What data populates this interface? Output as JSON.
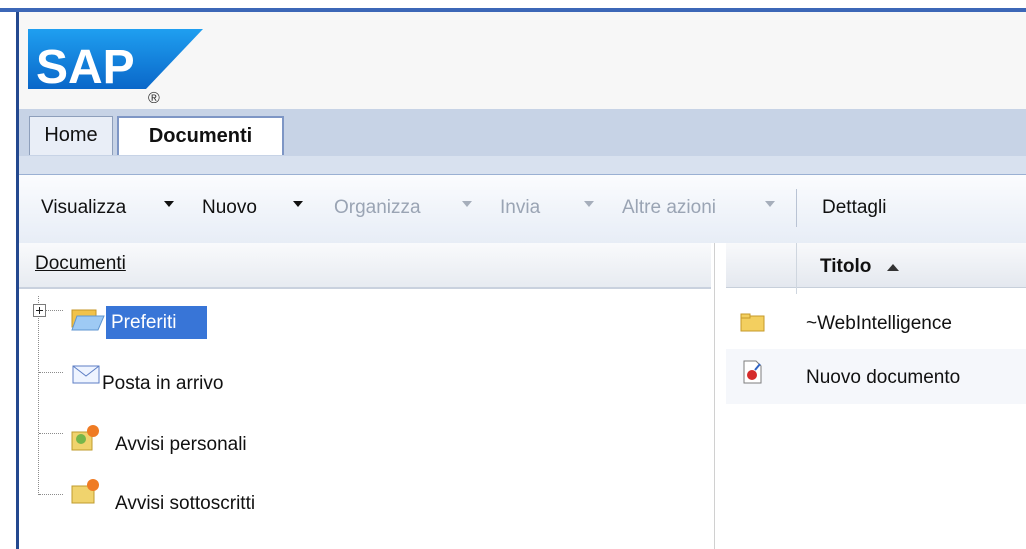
{
  "brand": {
    "logo_text": "SAP",
    "registered_mark": "®",
    "colors": {
      "logo_blue": "#0a7ad5",
      "accent": "#3875d7"
    }
  },
  "tabs": [
    {
      "label": "Home"
    },
    {
      "label": "Documenti"
    }
  ],
  "toolbar": {
    "items": [
      {
        "label": "Visualizza"
      },
      {
        "label": "Nuovo"
      },
      {
        "label": "Organizza"
      },
      {
        "label": "Invia"
      },
      {
        "label": "Altre azioni"
      },
      {
        "label": "Dettagli"
      }
    ]
  },
  "tree": {
    "header": "Documenti",
    "items": [
      {
        "label": "Preferiti",
        "icon": "open-folder-icon"
      },
      {
        "label": "Posta in arrivo",
        "icon": "mail-icon"
      },
      {
        "label": "Avvisi personali",
        "icon": "personal-alert-icon"
      },
      {
        "label": "Avvisi sottoscritti",
        "icon": "subscribed-alert-icon"
      }
    ]
  },
  "list": {
    "header": "Titolo",
    "rows": [
      {
        "title": "~WebIntelligence",
        "icon": "folder-icon"
      },
      {
        "title": "Nuovo documento",
        "icon": "document-icon"
      }
    ]
  }
}
